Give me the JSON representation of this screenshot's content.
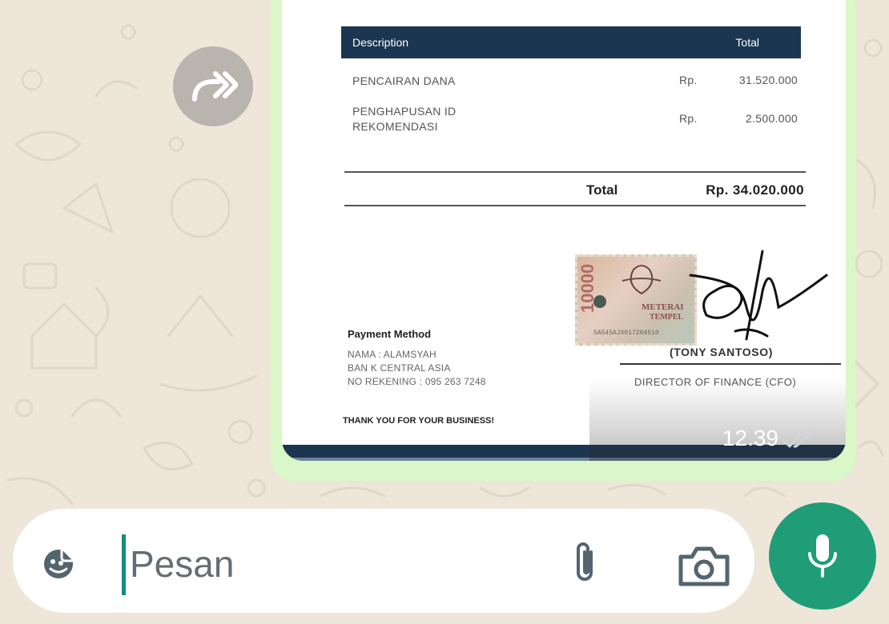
{
  "invoice": {
    "header": {
      "description": "Description",
      "total": "Total"
    },
    "items": [
      {
        "description": "PENCAIRAN DANA",
        "currency": "Rp.",
        "amount": "31.520.000"
      },
      {
        "description": "PENGHAPUSAN ID REKOMENDASI",
        "currency": "Rp.",
        "amount": "2.500.000"
      }
    ],
    "total_label": "Total",
    "total_amount": "Rp. 34.020.000",
    "payment": {
      "title": "Payment Method",
      "lines": [
        "NAMA : ALAMSYAH",
        "BAN K CENTRAL ASIA",
        "NO REKENING : 095 263 7248"
      ]
    },
    "stamp_serial": "5A545AJX017204510",
    "signer_name": "(TONY SANTOSO)",
    "signer_title": "DIRECTOR OF FINANCE (CFO)",
    "thanks": "THANK YOU FOR YOUR BUSINESS!"
  },
  "message": {
    "time": "12.39",
    "status": "read"
  },
  "composer": {
    "placeholder": "Pesan"
  },
  "colors": {
    "accent": "#1f9d77",
    "bubble": "#d9f7c8",
    "invoice_header": "#1c3550",
    "wallpaper": "#efe6da"
  },
  "icons": {
    "forward": "forward-icon",
    "sticker": "sticker-icon",
    "attach": "paperclip-icon",
    "camera": "camera-icon",
    "mic": "mic-icon"
  }
}
